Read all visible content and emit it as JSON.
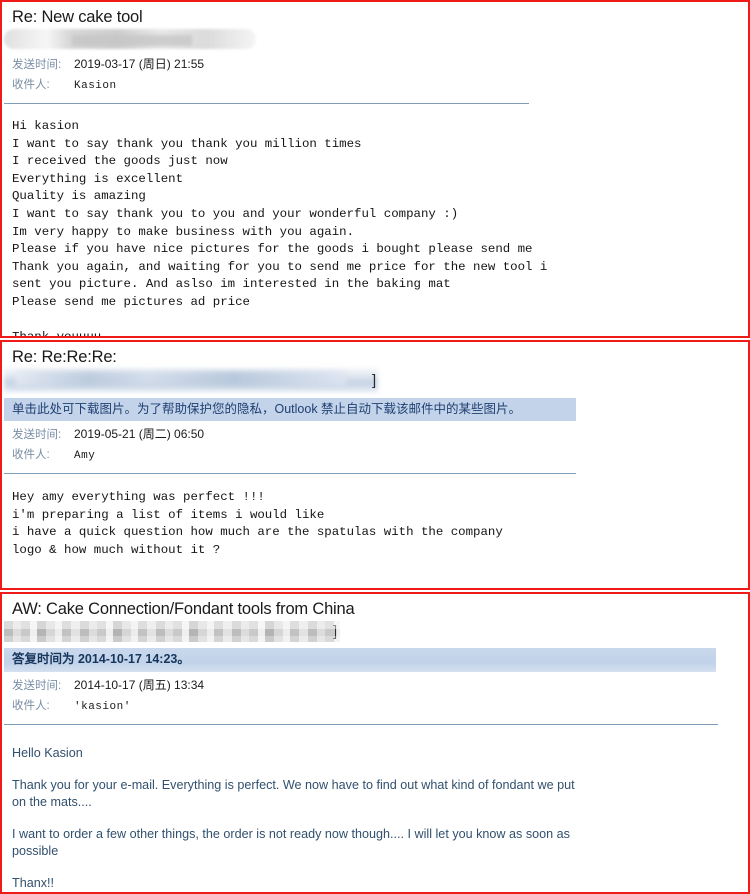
{
  "meta": {
    "frame_color": "#ee1b18",
    "banner_bg": "#c3d4ea",
    "label_color": "#7a8fa6",
    "rule_color": "#7f9db9"
  },
  "emails": [
    {
      "subject": "Re: New cake tool",
      "sender_redacted": true,
      "labels": {
        "sent": "发送时间:",
        "to": "收件人:"
      },
      "sent_value": "2019-03-17 (周日) 21:55",
      "to_value": "Kasion",
      "body": "Hi kasion\nI want to say thank you thank you million times\nI received the goods just now\nEverything is excellent\nQuality is amazing\nI want to say thank you to you and your wonderful company :)\nIm very happy to make business with you again.\nPlease if you have nice pictures for the goods i bought please send me\nThank you again, and waiting for you to send me price for the new tool i\nsent you picture. And aslso im interested in the baking mat\nPlease send me pictures ad price\n\nThank youuuu"
    },
    {
      "subject": "Re: Re:Re:Re:",
      "sender_redacted": true,
      "bracket": "]",
      "banner": "单击此处可下载图片。为了帮助保护您的隐私，Outlook 禁止自动下载该邮件中的某些图片。",
      "labels": {
        "sent": "发送时间:",
        "to": "收件人:"
      },
      "sent_value": "2019-05-21 (周二) 06:50",
      "to_value": "Amy",
      "body": "Hey amy everything was perfect !!!\ni'm preparing a list of items i would like\ni have a quick question how much are the spatulas with the company\nlogo & how much without it ?"
    },
    {
      "subject": "AW: Cake Connection/Fondant tools from China",
      "sender_redacted": true,
      "bracket": "]",
      "banner": "答复时间为 2014-10-17 14:23。",
      "labels": {
        "sent": "发送时间:",
        "to": "收件人:"
      },
      "sent_value": "2014-10-17 (周五) 13:34",
      "to_value": "'kasion'",
      "body_paragraphs": [
        "Hello Kasion",
        "Thank you for your e-mail. Everything is perfect. We now have to find out what kind of fondant we put on the mats....",
        "I want to order a few other things, the order is not ready now though.... I will let you know as soon as possible",
        "Thanx!!"
      ]
    }
  ]
}
